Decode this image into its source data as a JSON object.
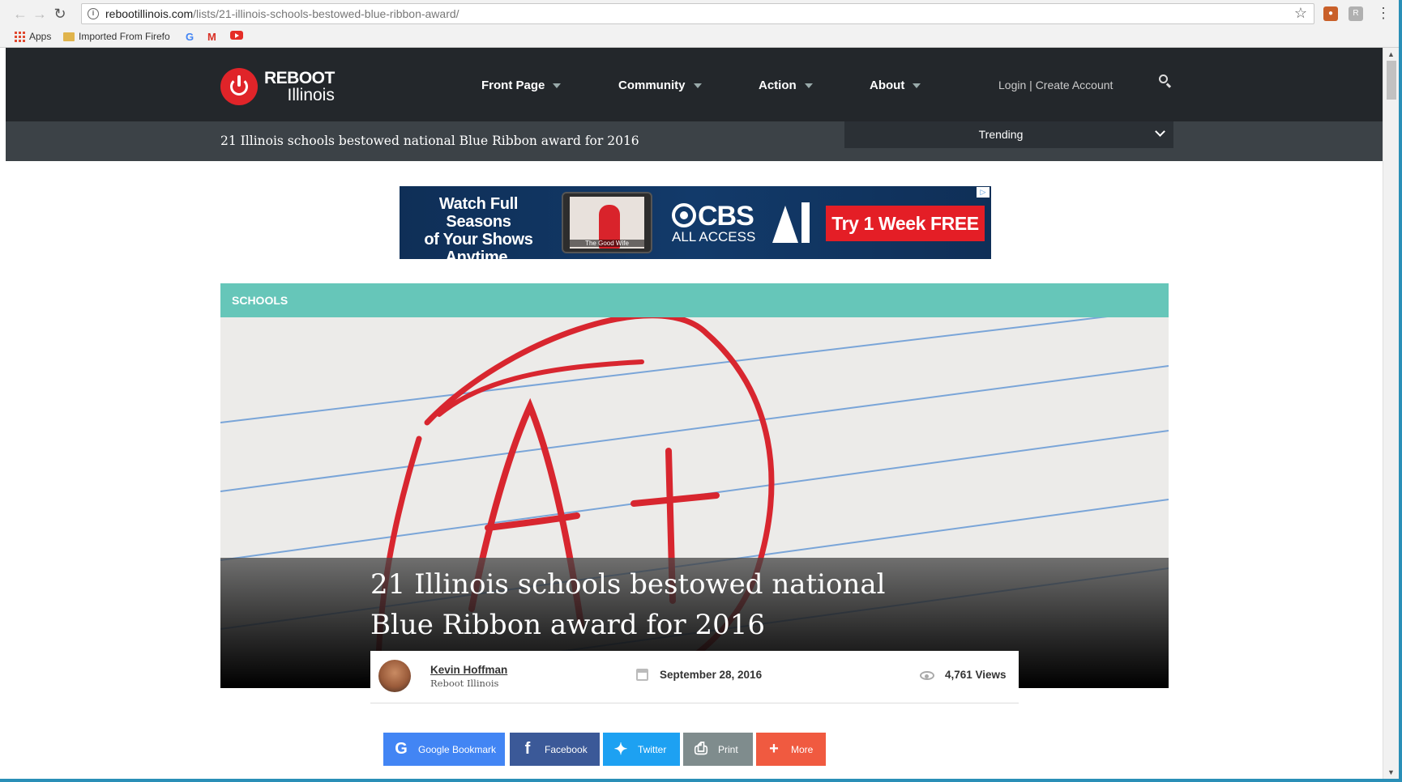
{
  "browser": {
    "url_host": "rebootillinois.com",
    "url_path": "/lists/21-illinois-schools-bestowed-blue-ribbon-award/",
    "bookmarks": [
      {
        "label": "Apps"
      },
      {
        "label": "Imported From Firefo"
      }
    ]
  },
  "site": {
    "logo": {
      "line1": "REBOOT",
      "line2": "Illinois"
    },
    "nav": [
      {
        "label": "Front Page"
      },
      {
        "label": "Community"
      },
      {
        "label": "Action"
      },
      {
        "label": "About"
      }
    ],
    "login_label": "Login",
    "separator": "|",
    "create_account_label": "Create Account",
    "subbar_title": "21 Illinois schools bestowed national Blue Ribbon award for 2016",
    "trending_label": "Trending"
  },
  "ad": {
    "headline_lines": [
      "Watch Full Seasons",
      "of Your Shows",
      "Anytime, Anywhere."
    ],
    "show_caption": "The Good Wife",
    "brand": "CBS",
    "brand_sub": "ALL ACCESS",
    "cta": "Try 1 Week FREE",
    "colors": {
      "background": "#123a6a",
      "cta": "#e41e26"
    }
  },
  "article": {
    "category": "SCHOOLS",
    "title": "21 Illinois schools bestowed national Blue Ribbon award for 2016",
    "author": "Kevin Hoffman",
    "author_org": "Reboot Illinois",
    "date": "September 28, 2016",
    "views": "4,761 Views",
    "accent_color": "#66c6b9"
  },
  "share": [
    {
      "label": "Google Bookmark",
      "icon": "google-icon",
      "color": "#4285f4"
    },
    {
      "label": "Facebook",
      "icon": "facebook-icon",
      "color": "#3b5998"
    },
    {
      "label": "Twitter",
      "icon": "twitter-icon",
      "color": "#1da1f2"
    },
    {
      "label": "Print",
      "icon": "print-icon",
      "color": "#7f8c8d"
    },
    {
      "label": "More",
      "icon": "plus-icon",
      "color": "#f05a40"
    }
  ]
}
